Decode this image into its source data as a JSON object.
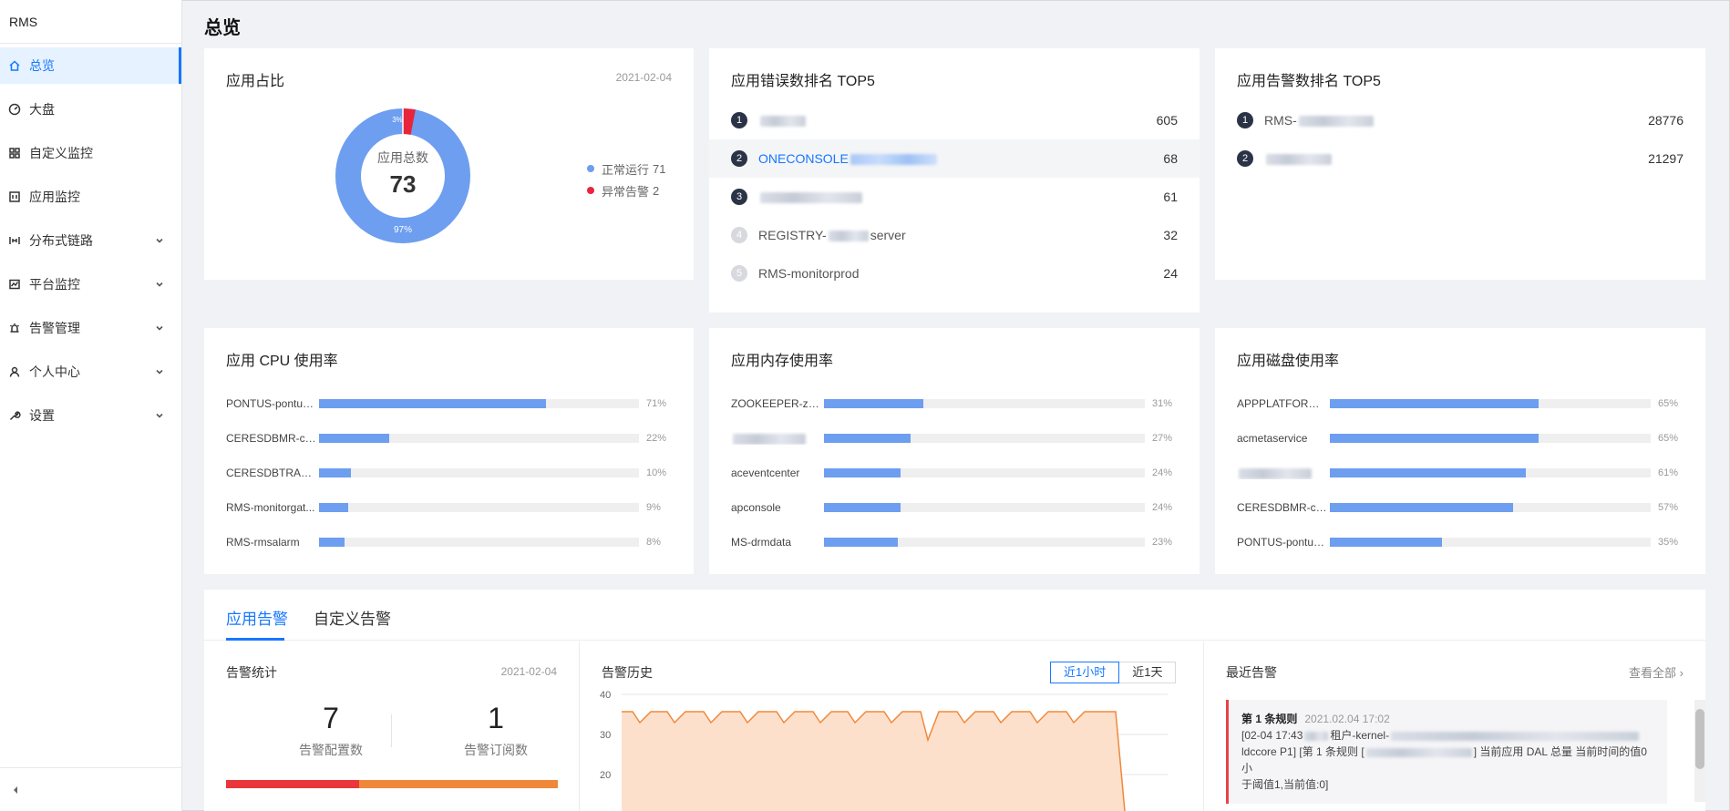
{
  "app": {
    "brand": "RMS",
    "page_title": "总览"
  },
  "sidebar": {
    "items": [
      {
        "label": "总览",
        "icon": "home-icon",
        "active": true,
        "expandable": false
      },
      {
        "label": "大盘",
        "icon": "dashboard-icon",
        "active": false,
        "expandable": false
      },
      {
        "label": "自定义监控",
        "icon": "grid-icon",
        "active": false,
        "expandable": false
      },
      {
        "label": "应用监控",
        "icon": "app-icon",
        "active": false,
        "expandable": false
      },
      {
        "label": "分布式链路",
        "icon": "trace-icon",
        "active": false,
        "expandable": true
      },
      {
        "label": "平台监控",
        "icon": "line-chart-icon",
        "active": false,
        "expandable": true
      },
      {
        "label": "告警管理",
        "icon": "alarm-icon",
        "active": false,
        "expandable": true
      },
      {
        "label": "个人中心",
        "icon": "user-icon",
        "active": false,
        "expandable": true
      },
      {
        "label": "设置",
        "icon": "wrench-icon",
        "active": false,
        "expandable": true
      }
    ]
  },
  "app_ratio": {
    "title": "应用占比",
    "date": "2021-02-04",
    "center_label": "应用总数",
    "total": "73",
    "normal_pct_label": "97%",
    "abnormal_pct_label": "3%",
    "normal_fraction": 0.97,
    "legend": [
      {
        "label": "正常运行",
        "count": "71",
        "color": "#6d9ef0"
      },
      {
        "label": "异常告警",
        "count": "2",
        "color": "#e8253a"
      }
    ]
  },
  "error_rank": {
    "title": "应用错误数排名 TOP5",
    "rows": [
      {
        "rank": "1",
        "prefix": "",
        "suffix": "",
        "value": "605"
      },
      {
        "rank": "2",
        "prefix": "ONECONSOLE",
        "suffix": "",
        "value": "68"
      },
      {
        "rank": "3",
        "prefix": "",
        "suffix": "",
        "value": "61"
      },
      {
        "rank": "4",
        "prefix": "REGISTRY-",
        "suffix": "server",
        "value": "32"
      },
      {
        "rank": "5",
        "prefix": "RMS-monitorprod",
        "suffix": "",
        "value": "24"
      }
    ]
  },
  "alarm_rank": {
    "title": "应用告警数排名 TOP5",
    "rows": [
      {
        "rank": "1",
        "prefix": "RMS-",
        "value": "28776"
      },
      {
        "rank": "2",
        "prefix": "",
        "value": "21297"
      }
    ]
  },
  "cpu_usage": {
    "title": "应用 CPU 使用率",
    "rows": [
      {
        "name": "PONTUS-pontus...",
        "pct": "71%",
        "value": 71
      },
      {
        "name": "CERESDBMR-cer...",
        "pct": "22%",
        "value": 22
      },
      {
        "name": "CERESDBTRACE-...",
        "pct": "10%",
        "value": 10
      },
      {
        "name": "RMS-monitorgat...",
        "pct": "9%",
        "value": 9
      },
      {
        "name": "RMS-rmsalarm",
        "pct": "8%",
        "value": 8
      }
    ]
  },
  "mem_usage": {
    "title": "应用内存使用率",
    "rows": [
      {
        "name": "ZOOKEEPER-zoo...",
        "pct": "31%",
        "value": 31
      },
      {
        "name": "",
        "pct": "27%",
        "value": 27
      },
      {
        "name": "aceventcenter",
        "pct": "24%",
        "value": 24
      },
      {
        "name": "apconsole",
        "pct": "24%",
        "value": 24
      },
      {
        "name": "MS-drmdata",
        "pct": "23%",
        "value": 23
      }
    ]
  },
  "disk_usage": {
    "title": "应用磁盘使用率",
    "rows": [
      {
        "name": "APPPLATFORM-...",
        "pct": "65%",
        "value": 65
      },
      {
        "name": "acmetaservice",
        "pct": "65%",
        "value": 65
      },
      {
        "name": "",
        "pct": "61%",
        "value": 61
      },
      {
        "name": "CERESDBMR-cer...",
        "pct": "57%",
        "value": 57
      },
      {
        "name": "PONTUS-pontus...",
        "pct": "35%",
        "value": 35
      }
    ]
  },
  "bottom": {
    "tabs": [
      {
        "label": "应用告警",
        "active": true
      },
      {
        "label": "自定义告警",
        "active": false
      }
    ],
    "stats": {
      "title": "告警统计",
      "date": "2021-02-04",
      "config_count": "7",
      "config_label": "告警配置数",
      "subscribe_count": "1",
      "subscribe_label": "告警订阅数",
      "red_share": 0.4,
      "colors": {
        "red": "#e8363b",
        "orange": "#f0883a"
      }
    },
    "history": {
      "title": "告警历史",
      "range_options": [
        "近1小时",
        "近1天"
      ],
      "selected_range": "近1小时",
      "y_ticks": [
        "40",
        "30",
        "20"
      ]
    },
    "recent": {
      "title": "最近告警",
      "view_all": "查看全部",
      "item": {
        "rule": "第 1 条规则",
        "time": "2021.02.04 17:02",
        "line1_a": "[02-04 17:43",
        "line1_b": "租户-kernel-",
        "line2_a": "ldccore P1] [第 1 条规则 [",
        "line2_b": "] 当前应用 DAL 总量 当前时间的值0小",
        "line3": "于阈值1,当前值:0]"
      }
    }
  }
}
